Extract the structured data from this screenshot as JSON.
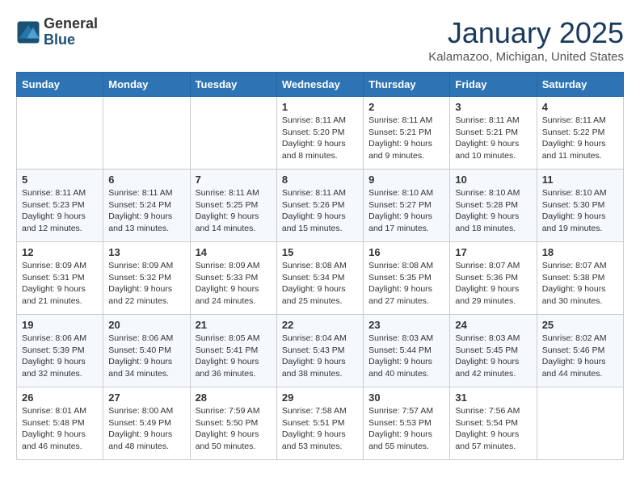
{
  "header": {
    "logo_general": "General",
    "logo_blue": "Blue",
    "month": "January 2025",
    "location": "Kalamazoo, Michigan, United States"
  },
  "days_of_week": [
    "Sunday",
    "Monday",
    "Tuesday",
    "Wednesday",
    "Thursday",
    "Friday",
    "Saturday"
  ],
  "weeks": [
    [
      {
        "day": "",
        "info": ""
      },
      {
        "day": "",
        "info": ""
      },
      {
        "day": "",
        "info": ""
      },
      {
        "day": "1",
        "info": "Sunrise: 8:11 AM\nSunset: 5:20 PM\nDaylight: 9 hours\nand 8 minutes."
      },
      {
        "day": "2",
        "info": "Sunrise: 8:11 AM\nSunset: 5:21 PM\nDaylight: 9 hours\nand 9 minutes."
      },
      {
        "day": "3",
        "info": "Sunrise: 8:11 AM\nSunset: 5:21 PM\nDaylight: 9 hours\nand 10 minutes."
      },
      {
        "day": "4",
        "info": "Sunrise: 8:11 AM\nSunset: 5:22 PM\nDaylight: 9 hours\nand 11 minutes."
      }
    ],
    [
      {
        "day": "5",
        "info": "Sunrise: 8:11 AM\nSunset: 5:23 PM\nDaylight: 9 hours\nand 12 minutes."
      },
      {
        "day": "6",
        "info": "Sunrise: 8:11 AM\nSunset: 5:24 PM\nDaylight: 9 hours\nand 13 minutes."
      },
      {
        "day": "7",
        "info": "Sunrise: 8:11 AM\nSunset: 5:25 PM\nDaylight: 9 hours\nand 14 minutes."
      },
      {
        "day": "8",
        "info": "Sunrise: 8:11 AM\nSunset: 5:26 PM\nDaylight: 9 hours\nand 15 minutes."
      },
      {
        "day": "9",
        "info": "Sunrise: 8:10 AM\nSunset: 5:27 PM\nDaylight: 9 hours\nand 17 minutes."
      },
      {
        "day": "10",
        "info": "Sunrise: 8:10 AM\nSunset: 5:28 PM\nDaylight: 9 hours\nand 18 minutes."
      },
      {
        "day": "11",
        "info": "Sunrise: 8:10 AM\nSunset: 5:30 PM\nDaylight: 9 hours\nand 19 minutes."
      }
    ],
    [
      {
        "day": "12",
        "info": "Sunrise: 8:09 AM\nSunset: 5:31 PM\nDaylight: 9 hours\nand 21 minutes."
      },
      {
        "day": "13",
        "info": "Sunrise: 8:09 AM\nSunset: 5:32 PM\nDaylight: 9 hours\nand 22 minutes."
      },
      {
        "day": "14",
        "info": "Sunrise: 8:09 AM\nSunset: 5:33 PM\nDaylight: 9 hours\nand 24 minutes."
      },
      {
        "day": "15",
        "info": "Sunrise: 8:08 AM\nSunset: 5:34 PM\nDaylight: 9 hours\nand 25 minutes."
      },
      {
        "day": "16",
        "info": "Sunrise: 8:08 AM\nSunset: 5:35 PM\nDaylight: 9 hours\nand 27 minutes."
      },
      {
        "day": "17",
        "info": "Sunrise: 8:07 AM\nSunset: 5:36 PM\nDaylight: 9 hours\nand 29 minutes."
      },
      {
        "day": "18",
        "info": "Sunrise: 8:07 AM\nSunset: 5:38 PM\nDaylight: 9 hours\nand 30 minutes."
      }
    ],
    [
      {
        "day": "19",
        "info": "Sunrise: 8:06 AM\nSunset: 5:39 PM\nDaylight: 9 hours\nand 32 minutes."
      },
      {
        "day": "20",
        "info": "Sunrise: 8:06 AM\nSunset: 5:40 PM\nDaylight: 9 hours\nand 34 minutes."
      },
      {
        "day": "21",
        "info": "Sunrise: 8:05 AM\nSunset: 5:41 PM\nDaylight: 9 hours\nand 36 minutes."
      },
      {
        "day": "22",
        "info": "Sunrise: 8:04 AM\nSunset: 5:43 PM\nDaylight: 9 hours\nand 38 minutes."
      },
      {
        "day": "23",
        "info": "Sunrise: 8:03 AM\nSunset: 5:44 PM\nDaylight: 9 hours\nand 40 minutes."
      },
      {
        "day": "24",
        "info": "Sunrise: 8:03 AM\nSunset: 5:45 PM\nDaylight: 9 hours\nand 42 minutes."
      },
      {
        "day": "25",
        "info": "Sunrise: 8:02 AM\nSunset: 5:46 PM\nDaylight: 9 hours\nand 44 minutes."
      }
    ],
    [
      {
        "day": "26",
        "info": "Sunrise: 8:01 AM\nSunset: 5:48 PM\nDaylight: 9 hours\nand 46 minutes."
      },
      {
        "day": "27",
        "info": "Sunrise: 8:00 AM\nSunset: 5:49 PM\nDaylight: 9 hours\nand 48 minutes."
      },
      {
        "day": "28",
        "info": "Sunrise: 7:59 AM\nSunset: 5:50 PM\nDaylight: 9 hours\nand 50 minutes."
      },
      {
        "day": "29",
        "info": "Sunrise: 7:58 AM\nSunset: 5:51 PM\nDaylight: 9 hours\nand 53 minutes."
      },
      {
        "day": "30",
        "info": "Sunrise: 7:57 AM\nSunset: 5:53 PM\nDaylight: 9 hours\nand 55 minutes."
      },
      {
        "day": "31",
        "info": "Sunrise: 7:56 AM\nSunset: 5:54 PM\nDaylight: 9 hours\nand 57 minutes."
      },
      {
        "day": "",
        "info": ""
      }
    ]
  ]
}
